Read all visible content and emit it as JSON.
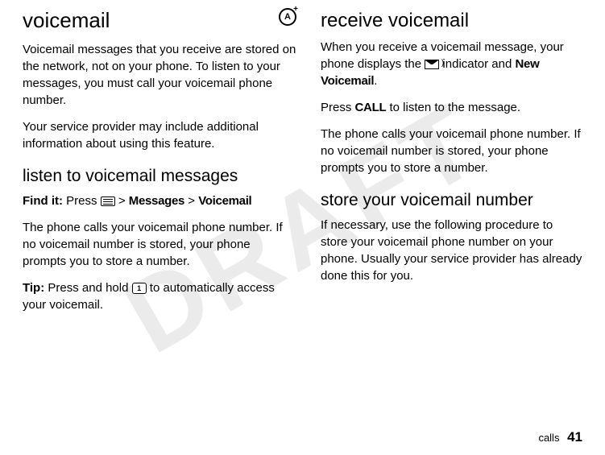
{
  "watermark": "DRAFT",
  "left": {
    "h1": "voicemail",
    "icon_label": "A",
    "p1": "Voicemail messages that you receive are stored on the network, not on your phone. To listen to your messages, you must call your voicemail phone number.",
    "p2": "Your service provider may include additional information about using this feature.",
    "h2": "listen to voicemail messages",
    "findit_prefix": "Find it:",
    "findit_press": " Press ",
    "findit_gt1": " > ",
    "findit_messages": "Messages",
    "findit_gt2": " > ",
    "findit_voicemail": "Voicemail",
    "p3": "The phone calls your voicemail phone number. If no voicemail number is stored, your phone prompts you to store a number.",
    "tip_prefix": "Tip:",
    "tip_a": " Press and hold ",
    "key_1": "1",
    "tip_b": " to automatically access your voicemail."
  },
  "right": {
    "h2a": "receive voicemail",
    "p1a": "When you receive a voicemail message, your phone displays the ",
    "p1b": " indicator and ",
    "p1c_bold": "New Voicemail",
    "p1d": ".",
    "p2a": "Press ",
    "p2b_bold": "CALL",
    "p2c": " to listen to the message.",
    "p3": "The phone calls your voicemail phone number. If no voicemail number is stored, your phone prompts you to store a number.",
    "h2b": "store your voicemail number",
    "p4": "If necessary, use the following procedure to store your voicemail phone number on your phone. Usually your service provider has already done this for you."
  },
  "footer": {
    "section": "calls",
    "page": "41"
  }
}
